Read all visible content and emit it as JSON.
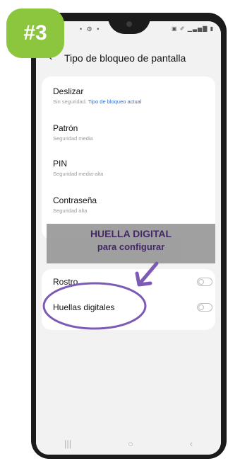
{
  "badge": {
    "text": "#3"
  },
  "status_bar": {
    "left": "• ⚙ •",
    "right": "▣ ✐ ▁▃▅▇ ▮"
  },
  "header": {
    "back": "‹",
    "title": "Tipo de bloqueo de pantalla"
  },
  "lock_options": [
    {
      "title": "Deslizar",
      "subtitle": "Sin seguridad.",
      "link": "Tipo de bloqueo actual"
    },
    {
      "title": "Patrón",
      "subtitle": "Seguridad media",
      "link": ""
    },
    {
      "title": "PIN",
      "subtitle": "Seguridad media-alta",
      "link": ""
    },
    {
      "title": "Contraseña",
      "subtitle": "Seguridad alta",
      "link": ""
    }
  ],
  "biometrics": [
    {
      "label": "Rostro",
      "enabled": false
    },
    {
      "label": "Huellas digitales",
      "enabled": false
    }
  ],
  "annotation": {
    "line1": "HUELLA DIGITAL",
    "line2": "para configurar",
    "color": "#7b5bb5"
  },
  "navbar": {
    "recents": "|||",
    "home": "○",
    "back": "‹"
  }
}
